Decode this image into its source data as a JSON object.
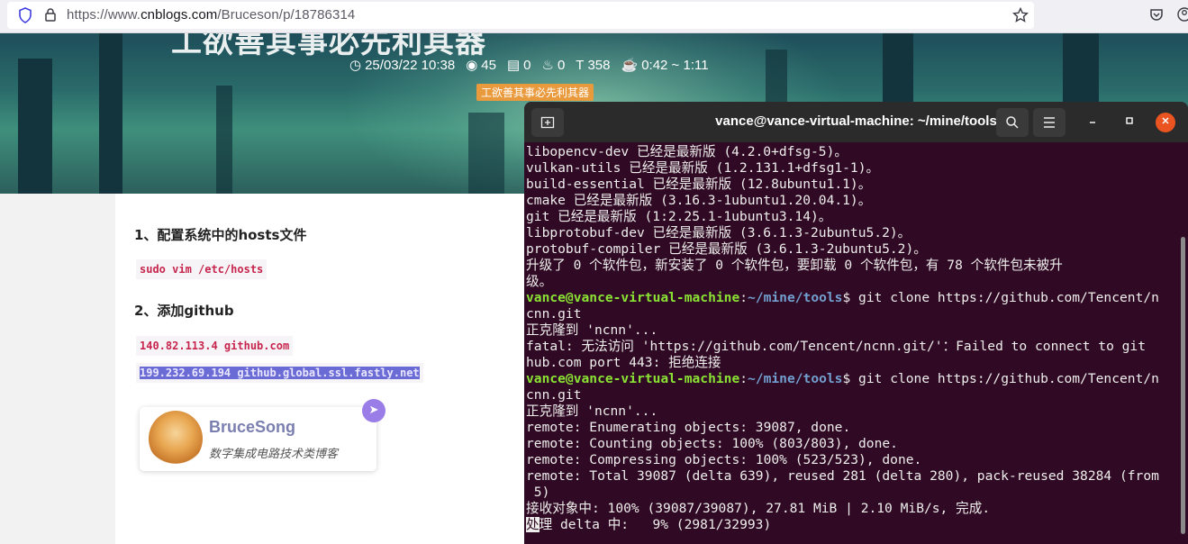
{
  "browser": {
    "url_prefix": "https://www.",
    "url_host": "cnblogs.com",
    "url_path": "/Bruceson/p/18786314",
    "shield_icon": "shield-icon",
    "lock_icon": "lock-icon",
    "star_icon": "star-icon",
    "pocket_icon": "pocket-icon",
    "account_icon": "account-icon"
  },
  "hero": {
    "title": "工欲善其事必先利其器",
    "date": "25/03/22 10:38",
    "views": "45",
    "comments": "0",
    "likes": "0",
    "words": "358",
    "read_time": "0:42 ~ 1:11",
    "tag": "工欲善其事必先利其器"
  },
  "article": {
    "step1_heading": "1、配置系统中的hosts文件",
    "step1_code": "sudo vim /etc/hosts",
    "step2_heading": "2、添加github",
    "step2_code1": "140.82.113.4 github.com",
    "step2_code2": "199.232.69.194 github.global.ssl.fastly.net"
  },
  "author_card": {
    "name": "BruceSong",
    "description": "数字集成电路技术类博客"
  },
  "terminal": {
    "title": "vance@vance-virtual-machine: ~/mine/tools",
    "prompt_user": "vance@vance-virtual-machine",
    "prompt_sep": ":",
    "prompt_path": "~/mine/tools",
    "prompt_end": "$ ",
    "lines": [
      {
        "type": "text",
        "text": "libopencv-dev 已经是最新版 (4.2.0+dfsg-5)。"
      },
      {
        "type": "text",
        "text": "vulkan-utils 已经是最新版 (1.2.131.1+dfsg1-1)。"
      },
      {
        "type": "text",
        "text": "build-essential 已经是最新版 (12.8ubuntu1.1)。"
      },
      {
        "type": "text",
        "text": "cmake 已经是最新版 (3.16.3-1ubuntu1.20.04.1)。"
      },
      {
        "type": "text",
        "text": "git 已经是最新版 (1:2.25.1-1ubuntu3.14)。"
      },
      {
        "type": "text",
        "text": "libprotobuf-dev 已经是最新版 (3.6.1.3-2ubuntu5.2)。"
      },
      {
        "type": "text",
        "text": "protobuf-compiler 已经是最新版 (3.6.1.3-2ubuntu5.2)。"
      },
      {
        "type": "text",
        "text": "升级了 0 个软件包，新安装了 0 个软件包，要卸载 0 个软件包，有 78 个软件包未被升"
      },
      {
        "type": "text",
        "text": "级。"
      },
      {
        "type": "prompt",
        "text": "git clone https://github.com/Tencent/n"
      },
      {
        "type": "text",
        "text": "cnn.git"
      },
      {
        "type": "text",
        "text": "正克隆到 'ncnn'..."
      },
      {
        "type": "text",
        "text": "fatal: 无法访问 'https://github.com/Tencent/ncnn.git/'：Failed to connect to git"
      },
      {
        "type": "text",
        "text": "hub.com port 443: 拒绝连接"
      },
      {
        "type": "prompt",
        "text": "git clone https://github.com/Tencent/n"
      },
      {
        "type": "text",
        "text": "cnn.git"
      },
      {
        "type": "text",
        "text": "正克隆到 'ncnn'..."
      },
      {
        "type": "text",
        "text": "remote: Enumerating objects: 39087, done."
      },
      {
        "type": "text",
        "text": "remote: Counting objects: 100% (803/803), done."
      },
      {
        "type": "text",
        "text": "remote: Compressing objects: 100% (523/523), done."
      },
      {
        "type": "text",
        "text": "remote: Total 39087 (delta 639), reused 281 (delta 280), pack-reused 38284 (from"
      },
      {
        "type": "text",
        "text": " 5)"
      },
      {
        "type": "text",
        "text": "接收对象中: 100% (39087/39087), 27.81 MiB | 2.10 MiB/s, 完成."
      },
      {
        "type": "cursor",
        "cursor": "处",
        "text": "理 delta 中:   9% (2981/32993)"
      }
    ]
  }
}
